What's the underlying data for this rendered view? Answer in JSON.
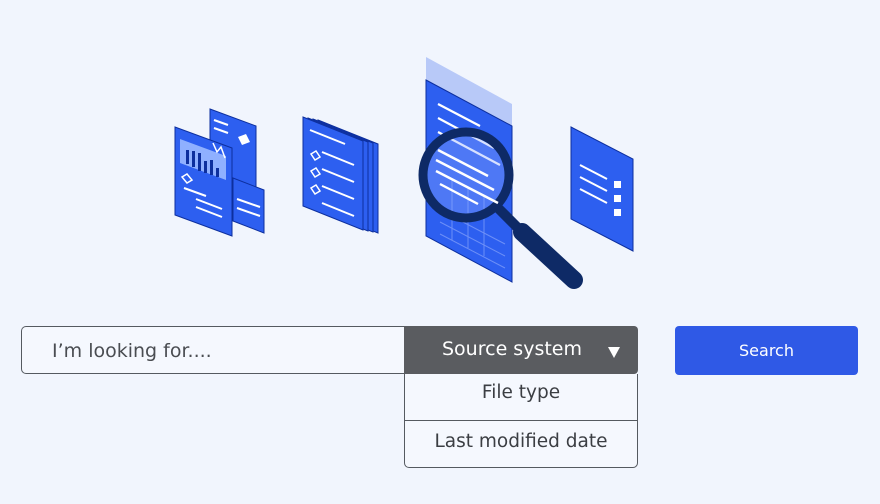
{
  "search": {
    "placeholder": "I’m looking for...."
  },
  "filter_dropdown": {
    "selected_label": "Source system",
    "options": [
      "File type",
      "Last modified date"
    ]
  },
  "search_button": {
    "label": "Search"
  },
  "colors": {
    "accent": "#2f59e6",
    "dropdown_bg": "#5a5c60",
    "illustration_blue": "#2d5ff0",
    "magnifier": "#0e2a66",
    "page_bg": "#f1f5fd"
  }
}
